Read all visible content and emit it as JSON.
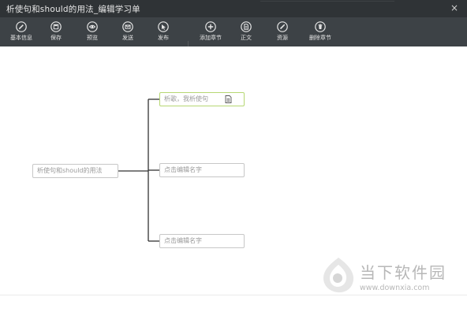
{
  "window": {
    "title": "析使句和should的用法_编辑学习单",
    "close_glyph": "×"
  },
  "toolbar": {
    "items": [
      {
        "label": "基本信息",
        "icon": "pencil-icon"
      },
      {
        "label": "保存",
        "icon": "save-icon"
      },
      {
        "label": "预览",
        "icon": "eye-icon"
      },
      {
        "label": "发送",
        "icon": "send-icon"
      },
      {
        "label": "发布",
        "icon": "cursor-icon"
      },
      {
        "label": "添加章节",
        "icon": "add-icon"
      },
      {
        "label": "正文",
        "icon": "document-icon"
      },
      {
        "label": "资源",
        "icon": "resource-icon"
      },
      {
        "label": "删除章节",
        "icon": "trash-icon"
      }
    ]
  },
  "mindmap": {
    "root": "析使句和should的用法",
    "children": [
      {
        "label": "析歌，我析使句",
        "active": true
      },
      {
        "label": "点击编辑名字",
        "active": false
      },
      {
        "label": "点击编辑名字",
        "active": false
      }
    ]
  },
  "watermark": {
    "brand": "当下软件园",
    "url": "www.downxia.com"
  },
  "colors": {
    "titlebar_bg": "#2f3336",
    "toolbar_bg": "#3d4246",
    "active_node_border": "#b6d773",
    "node_border": "#c7c7c7"
  }
}
